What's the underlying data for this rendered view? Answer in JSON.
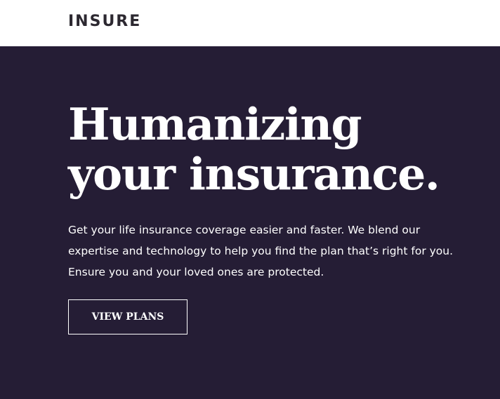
{
  "header": {
    "logo_text": "INSURE"
  },
  "hero": {
    "headline_line1": "Humanizing",
    "headline_line2": "your insurance.",
    "description": "Get your life insurance coverage easier and faster. We blend our expertise and technology to help you find the plan that’s right for you. Ensure you and your loved ones are protected.",
    "cta_label": "VIEW PLANS"
  },
  "colors": {
    "header_background": "#ffffff",
    "hero_background": "#251d35",
    "logo": "#2c2830",
    "hero_text": "#ffffff"
  }
}
